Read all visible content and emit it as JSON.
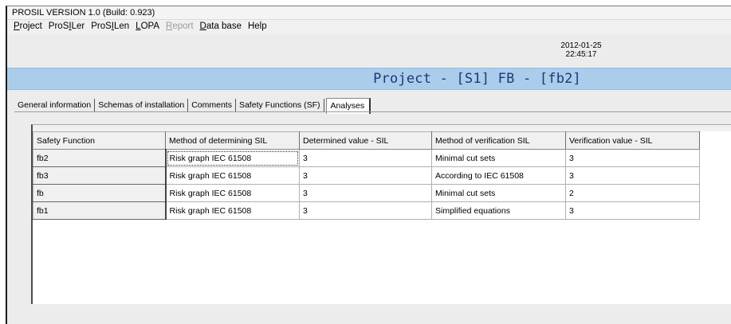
{
  "window": {
    "title": "PROSIL VERSION 1.0 (Build: 0.923)"
  },
  "menu": [
    {
      "label": "Project",
      "underline": "P",
      "rest": "roject",
      "prefix": "",
      "disabled": false
    },
    {
      "label": "ProSILer",
      "prefix": "ProS",
      "underline": "I",
      "rest": "Ler",
      "disabled": false
    },
    {
      "label": "ProSILen",
      "prefix": "ProS",
      "underline": "I",
      "rest": "Len",
      "disabled": false
    },
    {
      "label": "LOPA",
      "prefix": "",
      "underline": "L",
      "rest": "OPA",
      "disabled": false
    },
    {
      "label": "Report",
      "prefix": "",
      "underline": "R",
      "rest": "eport",
      "disabled": true
    },
    {
      "label": "Data base",
      "prefix": "",
      "underline": "D",
      "rest": "ata base",
      "disabled": false
    },
    {
      "label": "Help",
      "prefix": "",
      "underline": "",
      "rest": "Help",
      "disabled": false
    }
  ],
  "datetime": {
    "date": "2012-01-25",
    "time": "22:45:17"
  },
  "project": {
    "title": "Project - [S1] FB - [fb2]"
  },
  "tabs": [
    {
      "label": "General information",
      "active": false
    },
    {
      "label": "Schemas of installation",
      "active": false
    },
    {
      "label": "Comments",
      "active": false
    },
    {
      "label": "Safety Functions (SF)",
      "active": false
    },
    {
      "label": "Analyses",
      "active": true
    }
  ],
  "grid": {
    "columns": [
      "Safety Function",
      "Method of determining SIL",
      "Determined value - SIL",
      "Method of verification SIL",
      "Verification value - SIL"
    ],
    "rows": [
      [
        "fb2",
        "Risk graph IEC 61508",
        "3",
        "Minimal cut sets",
        "3"
      ],
      [
        "fb3",
        "Risk graph IEC 61508",
        "3",
        "According to IEC 61508",
        "3"
      ],
      [
        "fb",
        "Risk graph IEC 61508",
        "3",
        "Minimal cut sets",
        "2"
      ],
      [
        "fb1",
        "Risk graph IEC 61508",
        "3",
        "Simplified equations",
        "3"
      ]
    ]
  },
  "colors": {
    "project_bar": "#a9cdea",
    "project_title": "#22357a",
    "window_bg": "#ececec"
  }
}
